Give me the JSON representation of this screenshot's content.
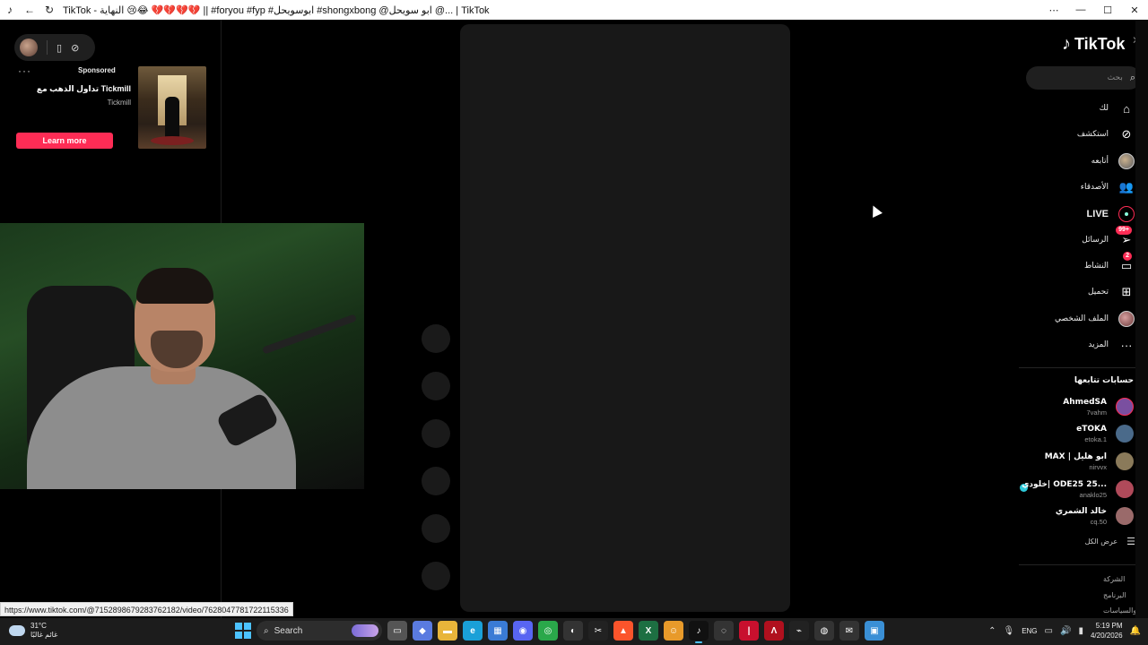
{
  "window": {
    "title": "TikTok - النهاية 😢😂 💔💔💔💔 || #foryou #fyp #ابوسويحل #shongxbong @ابو سويحل @... | TikTok",
    "controls": {
      "menu": "⋯",
      "minimize": "—",
      "maximize": "☐",
      "close": "✕"
    }
  },
  "ad": {
    "sponsored_label": "Sponsored",
    "headline": "تداول الذهب مع Tickmill",
    "brand": "Tickmill",
    "cta": "Learn more",
    "more_dots": "···"
  },
  "sidebar": {
    "logo_text": "TikTok",
    "search_placeholder": "بحث",
    "nav": [
      {
        "label": "لك",
        "icon": "home-icon"
      },
      {
        "label": "استكشف",
        "icon": "compass-icon"
      },
      {
        "label": "أتابعه",
        "icon": "avatar-icon"
      },
      {
        "label": "الأصدقاء",
        "icon": "friends-icon"
      },
      {
        "label": "LIVE",
        "icon": "live-icon"
      },
      {
        "label": "الرسائل",
        "icon": "messages-icon",
        "badge": "99+"
      },
      {
        "label": "النشاط",
        "icon": "activity-icon",
        "badge": "2"
      },
      {
        "label": "تحميل",
        "icon": "upload-icon"
      },
      {
        "label": "الملف الشخصي",
        "icon": "profile-icon"
      },
      {
        "label": "المزيد",
        "icon": "more-icon"
      }
    ],
    "following_title": "حسابات تتابعها",
    "following": [
      {
        "name": "AhmedSA",
        "handle": "7vahm",
        "color": "#7a4fa0",
        "live": false
      },
      {
        "name": "eTOKA",
        "handle": "etoka.1",
        "color": "#4a6a8a",
        "live": false
      },
      {
        "name": "MAX | ابو هليل",
        "handle": "nirvvx",
        "color": "#8a7a5a",
        "live": false
      },
      {
        "name": "خلودي| ODE25 25...",
        "handle": "anaklo25",
        "color": "#b04a5a",
        "live": true
      },
      {
        "name": "خالد الشمري",
        "handle": "cq.50",
        "color": "#9a6a6a",
        "live": false
      }
    ],
    "see_all": "عرض الكل",
    "footer": [
      "الشركة",
      "البرنامج",
      "الشروط والسياسات"
    ]
  },
  "status_url": "https://www.tiktok.com/@7152898679283762182/video/7628047781722115336",
  "taskbar": {
    "weather_temp": "31°C",
    "weather_desc": "غائم غالبًا",
    "search_label": "Search",
    "lang": "ENG",
    "time": "5:19 PM",
    "date": "4/20/2026",
    "apps": [
      {
        "name": "task-view",
        "color": "#555",
        "glyph": "▭"
      },
      {
        "name": "copilot",
        "color": "#5a7be0",
        "glyph": "◆"
      },
      {
        "name": "file-explorer",
        "color": "#e8b53a",
        "glyph": "▬"
      },
      {
        "name": "edge",
        "color": "#1aa0d8",
        "glyph": "e"
      },
      {
        "name": "store",
        "color": "#3a7bd5",
        "glyph": "▦"
      },
      {
        "name": "discord",
        "color": "#5865f2",
        "glyph": "◉"
      },
      {
        "name": "chrome",
        "color": "#2aa84a",
        "glyph": "◎"
      },
      {
        "name": "obs",
        "color": "#333",
        "glyph": "◐"
      },
      {
        "name": "capcut",
        "color": "#222",
        "glyph": "✂"
      },
      {
        "name": "brave",
        "color": "#fb542b",
        "glyph": "▲"
      },
      {
        "name": "excel",
        "color": "#1d6f42",
        "glyph": "X"
      },
      {
        "name": "app-badge",
        "color": "#e89a2a",
        "glyph": "☺"
      },
      {
        "name": "tiktok",
        "color": "#111",
        "glyph": "♪"
      },
      {
        "name": "app-ring",
        "color": "#333",
        "glyph": "◌"
      },
      {
        "name": "app-red",
        "color": "#c8102e",
        "glyph": "|"
      },
      {
        "name": "app-arrow",
        "color": "#b0101e",
        "glyph": "Λ"
      },
      {
        "name": "app-cut",
        "color": "#222",
        "glyph": "⌁"
      },
      {
        "name": "app-globe",
        "color": "#333",
        "glyph": "◍"
      },
      {
        "name": "app-mail",
        "color": "#333",
        "glyph": "✉"
      },
      {
        "name": "app-photos",
        "color": "#3a8fd5",
        "glyph": "▣"
      }
    ]
  }
}
